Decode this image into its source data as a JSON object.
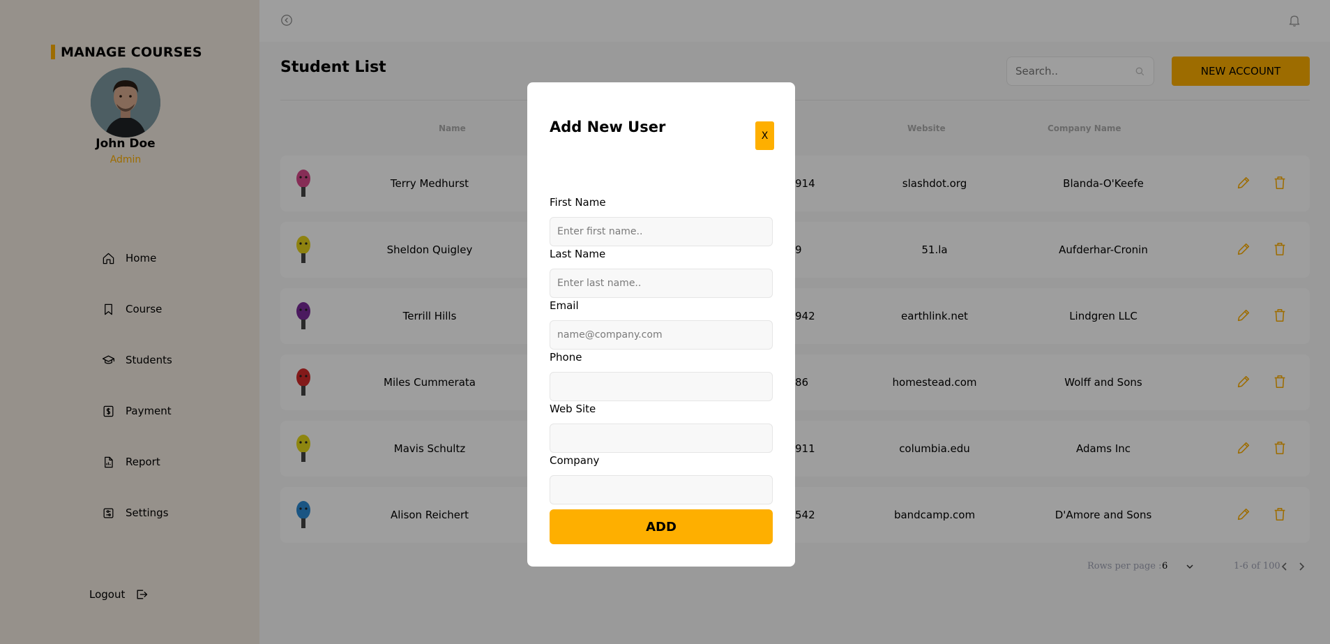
{
  "sidebar": {
    "brand": "MANAGE COURSES",
    "user": {
      "name": "John Doe",
      "role": "Admin"
    },
    "nav": [
      {
        "label": "Home",
        "icon": "home-icon"
      },
      {
        "label": "Course",
        "icon": "bookmark-icon"
      },
      {
        "label": "Students",
        "icon": "graduation-cap-icon"
      },
      {
        "label": "Payment",
        "icon": "dollar-icon"
      },
      {
        "label": "Report",
        "icon": "report-icon"
      },
      {
        "label": "Settings",
        "icon": "settings-icon"
      }
    ],
    "logout": "Logout"
  },
  "main": {
    "title": "Student List",
    "search_placeholder": "Search..",
    "new_account_label": "NEW ACCOUNT",
    "columns": [
      "Name",
      "Website",
      "Company Name"
    ],
    "rows": [
      {
        "name": "Terry Medhurst",
        "phone_fragment": "914",
        "website": "slashdot.org",
        "company": "Blanda-O'Keefe",
        "avatar_color": "#d94a8c"
      },
      {
        "name": "Sheldon Quigley",
        "phone_fragment": "9",
        "website": "51.la",
        "company": "Aufderhar-Cronin",
        "avatar_color": "#e6d21a"
      },
      {
        "name": "Terrill Hills",
        "phone_fragment": "942",
        "website": "earthlink.net",
        "company": "Lindgren LLC",
        "avatar_color": "#7a2a9a"
      },
      {
        "name": "Miles Cummerata",
        "phone_fragment": "86",
        "website": "homestead.com",
        "company": "Wolff and Sons",
        "avatar_color": "#d42a2a"
      },
      {
        "name": "Mavis Schultz",
        "phone_fragment": "911",
        "website": "columbia.edu",
        "company": "Adams Inc",
        "avatar_color": "#e6d81a"
      },
      {
        "name": "Alison Reichert",
        "phone_fragment": "542",
        "website": "bandcamp.com",
        "company": "D'Amore and Sons",
        "avatar_color": "#2a8ad4"
      }
    ],
    "rows_per_page_label": "Rows per page :",
    "rows_per_page_value": "6",
    "range_text": "1-6 of 100"
  },
  "modal": {
    "title": "Add New User",
    "close_label": "X",
    "fields": [
      {
        "label": "First Name",
        "placeholder": "Enter first name.."
      },
      {
        "label": "Last Name",
        "placeholder": "Enter last name.."
      },
      {
        "label": "Email",
        "placeholder": "name@company.com"
      },
      {
        "label": "Phone",
        "placeholder": ""
      },
      {
        "label": "Web Site",
        "placeholder": ""
      },
      {
        "label": "Company",
        "placeholder": ""
      }
    ],
    "submit_label": "ADD"
  },
  "colors": {
    "accent": "#feaf00",
    "sidebar_bg": "#f2eae1",
    "page_bg": "#f8f8f8"
  }
}
